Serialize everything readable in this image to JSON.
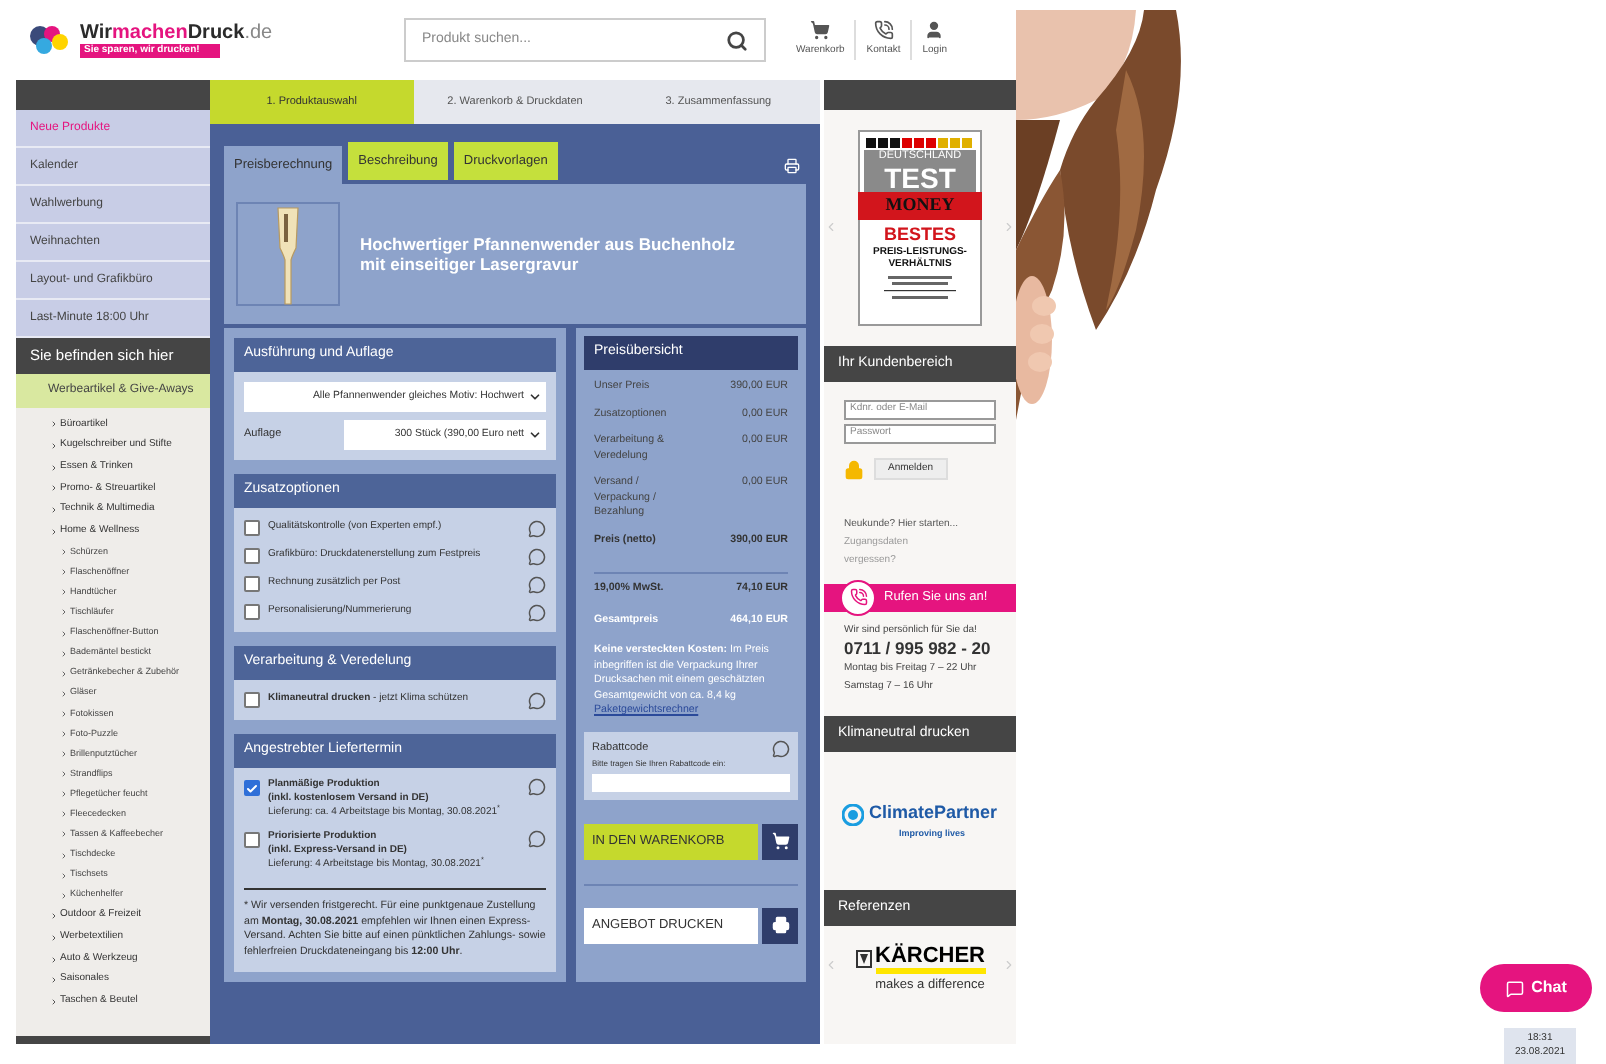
{
  "header": {
    "logo": {
      "part_1": "Wir",
      "part_2": "machen",
      "part_3": "Druck",
      "domain": ".de",
      "slogan": "Sie sparen, wir drucken!"
    },
    "search": {
      "placeholder": "Produkt suchen..."
    },
    "actions": [
      {
        "label": "Warenkorb",
        "kind": "cart"
      },
      {
        "label": "Kontakt",
        "kind": "phone"
      },
      {
        "label": "Login",
        "kind": "user"
      }
    ]
  },
  "steps": [
    {
      "label": "1. Produktauswahl",
      "selected": true
    },
    {
      "label": "2. Warenkorb & Druckdaten",
      "selected": false
    },
    {
      "label": "3. Zusammenfassung",
      "selected": false
    }
  ],
  "sidebar": {
    "top_categories": [
      {
        "label": "Neue Produkte",
        "highlighted": true
      },
      {
        "label": "Kalender",
        "highlighted": false
      },
      {
        "label": "Wahlwerbung",
        "highlighted": false
      },
      {
        "label": "Weihnachten",
        "highlighted": false
      },
      {
        "label": "Layout- und Grafikbüro",
        "highlighted": false
      },
      {
        "label": "Last-Minute 18:00 Uhr",
        "highlighted": false
      }
    ],
    "location_title": "Sie befinden sich hier",
    "current_category": "Werbeartikel & Give-Aways",
    "categories": [
      {
        "label": "Büroartikel"
      },
      {
        "label": "Kugelschreiber und Stifte"
      },
      {
        "label": "Essen & Trinken"
      },
      {
        "label": "Promo- & Streuartikel"
      },
      {
        "label": "Technik & Multimedia"
      },
      {
        "label": "Home & Wellness",
        "children": [
          {
            "label": "Schürzen"
          },
          {
            "label": "Flaschenöffner"
          },
          {
            "label": "Handtücher"
          },
          {
            "label": "Tischläufer"
          },
          {
            "label": "Flaschenöffner-Button"
          },
          {
            "label": "Bademäntel bestickt"
          },
          {
            "label": "Getränkebecher & Zubehör"
          },
          {
            "label": "Gläser"
          },
          {
            "label": "Fotokissen"
          },
          {
            "label": "Foto-Puzzle"
          },
          {
            "label": "Brillenputztücher"
          },
          {
            "label": "Strandflips"
          },
          {
            "label": "Pflegetücher feucht"
          },
          {
            "label": "Fleecedecken"
          },
          {
            "label": "Tassen & Kaffeebecher"
          },
          {
            "label": "Tischdecke"
          },
          {
            "label": "Tischsets"
          },
          {
            "label": "Küchenhelfer"
          }
        ]
      },
      {
        "label": "Outdoor & Freizeit"
      },
      {
        "label": "Werbetextilien"
      },
      {
        "label": "Auto & Werkzeug"
      },
      {
        "label": "Saisonales"
      },
      {
        "label": "Taschen & Beutel"
      }
    ]
  },
  "main": {
    "tabs": [
      {
        "label": "Preisberechnung",
        "selected": true
      },
      {
        "label": "Beschreibung",
        "selected": false
      },
      {
        "label": "Druckvorlagen",
        "selected": false
      }
    ],
    "product_title": "Hochwertiger Pfannenwender aus Buchenholz mit einseitiger Lasergravur",
    "configuration": {
      "title": "Ausführung und Auflage",
      "selects": [
        {
          "value": "Alle Pfannenwender gleiches Motiv: Hochwert"
        },
        {
          "label": "Auflage",
          "value": "300 Stück (390,00 Euro nett"
        }
      ]
    },
    "option_sections": [
      {
        "title": "Zusatzoptionen",
        "options": [
          {
            "label": "Qualitätskontrolle (von Experten empf.)",
            "checked": false
          },
          {
            "label": "Grafikbüro: Druckdatenerstellung zum Festpreis",
            "checked": false
          },
          {
            "label": "Rechnung zusätzlich per Post",
            "checked": false
          },
          {
            "label": "Personalisierung/Nummerierung",
            "checked": false
          }
        ]
      },
      {
        "title": "Verarbeitung & Veredelung",
        "options": [
          {
            "label": "**Klimaneutral drucken** - jetzt Klima schützen",
            "checked": false
          }
        ]
      }
    ],
    "delivery": {
      "title": "Angestrebter Liefertermin",
      "options": [
        {
          "title": "Planmäßige Produktion",
          "subtitle": "(inkl. kostenlosem Versand in DE)",
          "detail": "Lieferung: ca. 4 Arbeitstage bis Montag, 30.08.2021$^{*}$",
          "checked": true
        },
        {
          "title": "Priorisierte Produktion",
          "subtitle": "(inkl. Express-Versand in DE)",
          "detail": "Lieferung: 4 Arbeitstage bis Montag, 30.08.2021$^{*}$",
          "checked": false
        }
      ],
      "note": "* Wir versenden fristgerecht. Für eine punktgenaue Zustellung am **Montag, 30.08.2021** empfehlen wir Ihnen einen Express-Versand. Achten Sie bitte auf einen pünktlichen Zahlungs- sowie fehlerfreien Druckdateneingang bis **12:00 Uhr**."
    },
    "price": {
      "title": "Preisübersicht",
      "rows": [
        {
          "label": "Unser Preis",
          "value": "390,00 EUR",
          "kind": "normal"
        },
        {
          "label": "Zusatzoptionen",
          "value": "0,00 EUR",
          "kind": "normal"
        },
        {
          "label": "Verarbeitung & Veredelung",
          "value": "0,00 EUR",
          "kind": "normal"
        },
        {
          "label": "Versand / Verpackung / Bezahlung",
          "value": "0,00 EUR",
          "kind": "normal"
        },
        {
          "label": "Preis (netto)",
          "value": "390,00 EUR",
          "kind": "subtotal"
        },
        {
          "label": "19,00% MwSt.",
          "value": "74,10 EUR",
          "kind": "tax"
        },
        {
          "label": "Gesamtpreis",
          "value": "464,10 EUR",
          "kind": "total"
        }
      ],
      "hidden_costs": "**Keine versteckten Kosten:** Im Preis inbegriffen ist die Verpackung Ihrer Drucksachen mit einem geschätzten Gesamtgewicht von ca. 8,4 kg",
      "weight_link": "Paketgewichtsrechner",
      "discount": {
        "title": "Rabattcode",
        "hint": "Bitte tragen Sie Ihren Rabattcode ein:"
      },
      "buttons": [
        {
          "label": "IN DEN WARENKORB",
          "kind": "cart"
        },
        {
          "label": "ANGEBOT DRUCKEN",
          "kind": "print"
        }
      ]
    }
  },
  "right": {
    "seal": {
      "line_1": "DEUTSCHLAND",
      "line_2": "TEST",
      "brand": "MONEY",
      "award": "BESTES",
      "award_line_1": "PREIS-LEISTUNGS-",
      "award_line_2": "VERHÄLTNIS"
    },
    "account": {
      "title": "Ihr Kundenbereich",
      "fields": [
        {
          "placeholder": "Kdnr. oder E-Mail"
        },
        {
          "placeholder": "Passwort"
        }
      ],
      "login_button": "Anmelden",
      "new_customer": "Neukunde? Hier starten...",
      "forgot_link": "Zugangsdaten vergessen?"
    },
    "call": {
      "banner": "Rufen Sie uns an!",
      "intro": "Wir sind persönlich für Sie da!",
      "phone": "0711 / 995 982 - 20",
      "hours": [
        "Montag bis Freitag 7 – 22 Uhr",
        "Samstag 7 – 16 Uhr"
      ]
    },
    "climate": {
      "title": "Klimaneutral drucken",
      "logo": "ClimatePartner",
      "tagline": "Improving lives"
    },
    "references": {
      "title": "Referenzen",
      "logo": "KÄRCHER",
      "tagline": "makes a difference"
    }
  },
  "chat": {
    "label": "Chat"
  },
  "clock": {
    "time": "18:31",
    "date": "23.08.2021"
  }
}
